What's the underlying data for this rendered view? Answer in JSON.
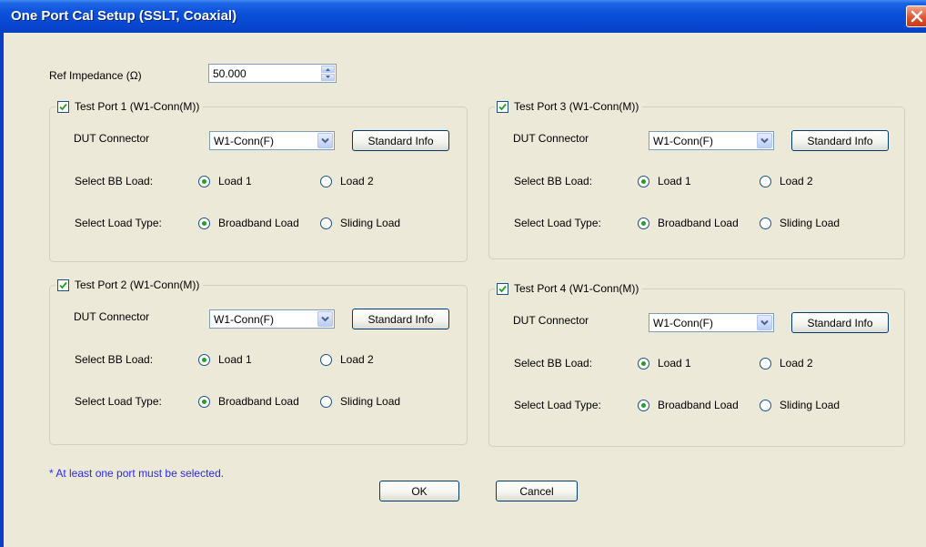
{
  "window": {
    "title": "One Port Cal Setup (SSLT, Coaxial)"
  },
  "ref_impedance": {
    "label": "Ref Impedance (Ω)",
    "value": "50.000"
  },
  "ports": [
    {
      "title": "Test Port 1 (W1-Conn(M))",
      "checked": true,
      "dut_label": "DUT Connector",
      "dut_value": "W1-Conn(F)",
      "standard_info": "Standard Info",
      "bb_label": "Select BB Load:",
      "load1": "Load 1",
      "load2": "Load 2",
      "load_selected": "Load 1",
      "type_label": "Select Load Type:",
      "broadband": "Broadband Load",
      "sliding": "Sliding Load",
      "type_selected": "Broadband Load"
    },
    {
      "title": "Test Port 2 (W1-Conn(M))",
      "checked": true,
      "dut_label": "DUT Connector",
      "dut_value": "W1-Conn(F)",
      "standard_info": "Standard Info",
      "bb_label": "Select BB Load:",
      "load1": "Load 1",
      "load2": "Load 2",
      "load_selected": "Load 1",
      "type_label": "Select Load Type:",
      "broadband": "Broadband Load",
      "sliding": "Sliding Load",
      "type_selected": "Broadband Load"
    },
    {
      "title": "Test Port 3 (W1-Conn(M))",
      "checked": true,
      "dut_label": "DUT Connector",
      "dut_value": "W1-Conn(F)",
      "standard_info": "Standard Info",
      "bb_label": "Select BB Load:",
      "load1": "Load 1",
      "load2": "Load 2",
      "load_selected": "Load 1",
      "type_label": "Select Load Type:",
      "broadband": "Broadband Load",
      "sliding": "Sliding Load",
      "type_selected": "Broadband Load"
    },
    {
      "title": "Test Port 4 (W1-Conn(M))",
      "checked": true,
      "dut_label": "DUT Connector",
      "dut_value": "W1-Conn(F)",
      "standard_info": "Standard Info",
      "bb_label": "Select BB Load:",
      "load1": "Load 1",
      "load2": "Load 2",
      "load_selected": "Load 1",
      "type_label": "Select Load Type:",
      "broadband": "Broadband Load",
      "sliding": "Sliding Load",
      "type_selected": "Broadband Load"
    }
  ],
  "note": "* At least one port must be selected.",
  "buttons": {
    "ok": "OK",
    "cancel": "Cancel"
  },
  "colors": {
    "titlebar": "#0a4fd8",
    "dialog_bg": "#ece9d8",
    "note_text": "#2a2ae6",
    "radio_dot": "#21a121",
    "check_mark": "#21a121",
    "close_button": "#e0552f"
  },
  "icons": {
    "close": "close-icon",
    "checkbox": "checkmark-icon",
    "dropdown": "chevron-down-icon",
    "spin_up": "spin-up-icon",
    "spin_down": "spin-down-icon"
  }
}
